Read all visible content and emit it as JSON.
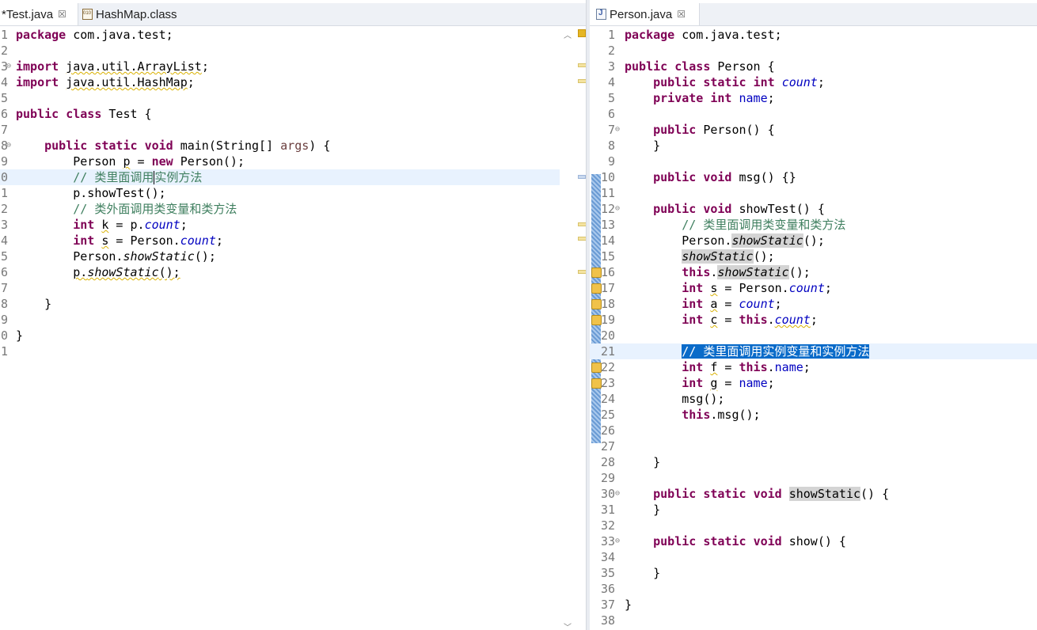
{
  "left_editor": {
    "tabs": [
      {
        "label": "*Test.java",
        "close": "☒",
        "icon": "java-file-icon",
        "active": true
      },
      {
        "label": "HashMap.class",
        "icon": "class-file-icon",
        "active": false
      }
    ],
    "line_numbers": [
      "1",
      "2",
      "3",
      "4",
      "5",
      "6",
      "7",
      "8",
      "9",
      "0",
      "1",
      "2",
      "3",
      "4",
      "5",
      "6",
      "7",
      "8",
      "9",
      "0",
      "1"
    ],
    "code": {
      "l1": {
        "kw": "package",
        "rest": " com.java.test;"
      },
      "l3": {
        "kw": "import",
        "sp": " ",
        "pkg": "java.util.ArrayList",
        "end": ";"
      },
      "l4": {
        "kw": "import",
        "sp": " ",
        "pkg": "java.util.HashMap",
        "end": ";"
      },
      "l6": {
        "kw1": "public",
        "kw2": "class",
        "rest": " Test {"
      },
      "l8": {
        "kw1": "public",
        "kw2": "static",
        "kw3": "void",
        "rest1": " main(String[] ",
        "param": "args",
        "rest2": ") {"
      },
      "l9": {
        "a": "Person ",
        "var": "p",
        "b": " = ",
        "kw": "new",
        "c": " Person();"
      },
      "l10": {
        "a": "// 类里面调用",
        "b": "实例方法"
      },
      "l11": {
        "text": "p.showTest();"
      },
      "l12": {
        "text": "// 类外面调用类变量和类方法"
      },
      "l13": {
        "kw": "int",
        "sp": " ",
        "var": "k",
        "a": " = p.",
        "field": "count",
        "end": ";"
      },
      "l14": {
        "kw": "int",
        "sp": " ",
        "var": "s",
        "a": " = Person.",
        "field": "count",
        "end": ";"
      },
      "l15": {
        "a": "Person.",
        "m": "showStatic",
        "end": "();"
      },
      "l16": {
        "a": "p.",
        "m": "showStatic",
        "end": "();"
      },
      "l18": {
        "text": "}"
      },
      "l20": {
        "text": "}"
      }
    }
  },
  "right_editor": {
    "tabs": [
      {
        "label": "Person.java",
        "close": "☒",
        "icon": "java-file-icon",
        "active": true
      }
    ],
    "line_numbers": [
      "1",
      "2",
      "3",
      "4",
      "5",
      "6",
      "7",
      "8",
      "9",
      "10",
      "11",
      "12",
      "13",
      "14",
      "15",
      "16",
      "17",
      "18",
      "19",
      "20",
      "21",
      "22",
      "23",
      "24",
      "25",
      "26",
      "27",
      "28",
      "29",
      "30",
      "31",
      "32",
      "33",
      "34",
      "35",
      "36",
      "37",
      "38"
    ],
    "code": {
      "l1": {
        "kw": "package",
        "rest": " com.java.test;"
      },
      "l3": {
        "kw1": "public",
        "kw2": "class",
        "rest": " Person {"
      },
      "l4": {
        "kw1": "public",
        "kw2": "static",
        "kw3": "int",
        "field": "count",
        "end": ";"
      },
      "l5": {
        "kw1": "private",
        "kw2": "int",
        "field": "name",
        "end": ";"
      },
      "l7": {
        "kw": "public",
        "rest": " Person() {"
      },
      "l8": {
        "text": "}"
      },
      "l10": {
        "kw1": "public",
        "kw2": "void",
        "rest": " msg() {}"
      },
      "l12": {
        "kw1": "public",
        "kw2": "void",
        "rest": " showTest() {"
      },
      "l13": {
        "text": "// 类里面调用类变量和类方法"
      },
      "l14": {
        "a": "Person.",
        "m": "showStatic",
        "end": "();"
      },
      "l15": {
        "m": "showStatic",
        "end": "();"
      },
      "l16": {
        "kw": "this",
        "a": ".",
        "m": "showStatic",
        "end": "();"
      },
      "l17": {
        "kw": "int",
        "sp": " ",
        "var": "s",
        "a": " = Person.",
        "field": "count",
        "end": ";"
      },
      "l18": {
        "kw": "int",
        "sp": " ",
        "var": "a",
        "a": " = ",
        "field": "count",
        "end": ";"
      },
      "l19": {
        "kw": "int",
        "sp": " ",
        "var": "c",
        "a": " = ",
        "kw2": "this",
        "dot": ".",
        "field": "count",
        "end": ";"
      },
      "l21": {
        "text": "// 类里面调用实例变量和实例方法"
      },
      "l22": {
        "kw": "int",
        "sp": " ",
        "var": "f",
        "a": " = ",
        "kw2": "this",
        "dot": ".",
        "field": "name",
        "end": ";"
      },
      "l23": {
        "kw": "int",
        "sp": " ",
        "var": "g",
        "a": " = ",
        "field": "name",
        "end": ";"
      },
      "l24": {
        "text": "msg();"
      },
      "l25": {
        "kw": "this",
        "rest": ".msg();"
      },
      "l28": {
        "text": "}"
      },
      "l30": {
        "kw1": "public",
        "kw2": "static",
        "kw3": "void",
        "sp": " ",
        "m": "showStatic",
        "rest": "() {"
      },
      "l31": {
        "text": "}"
      },
      "l33": {
        "kw1": "public",
        "kw2": "static",
        "kw3": "void",
        "rest": " show() {"
      },
      "l35": {
        "text": "}"
      },
      "l37": {
        "text": "}"
      }
    }
  },
  "colors": {
    "keyword": "#7f0055",
    "comment": "#3f7f5f",
    "field": "#0000c0",
    "selection": "#0a6bc9",
    "current_line": "#e8f2fe"
  },
  "icons": [
    "fold-collapse-icon",
    "warning-overview-marker",
    "quick-diff-ruler",
    "override-annotation-icon"
  ]
}
